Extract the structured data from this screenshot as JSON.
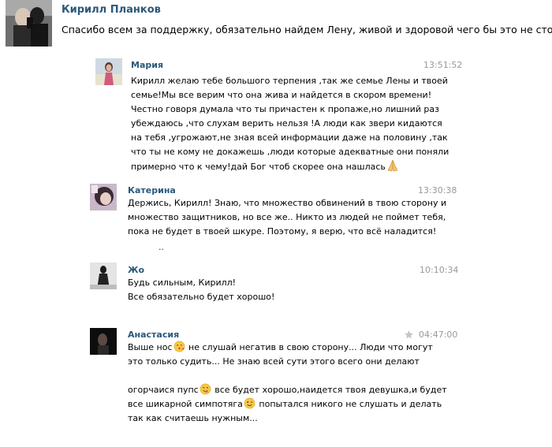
{
  "post": {
    "author": "Кирилл Планков",
    "text": "Спасибо всем за поддержку, обязательно найдем Лену, живой и здоровой чего бы это не стоило."
  },
  "comments": [
    {
      "name": "Мария",
      "time": "13:51:52",
      "lines": [
        "Кирилл желаю тебе большого терпения ,так же семье Лены и твоей",
        "семье!Мы все верим что она жива и найдется в скором времени!",
        "Честно говоря думала что ты причастен к пропаже,но лишний раз",
        "убеждаюсь ,что слухам верить нельзя !А люди как звери кидаются",
        "на тебя ,угрожают,не зная всей информации даже на половину ,так",
        "что ты не кому не докажешь ,люди которые адекватные они поняли",
        "примерно что к чему!дай Бог чтоб скорее она нашлась"
      ]
    },
    {
      "name": "Катерина",
      "time": "13:30:38",
      "lines": [
        "Держись, Кирилл! Знаю, что множество обвинений в твою сторону и",
        "множество защитников, но все же.. Никто из людей не поймет тебя,",
        "пока не будет в твоей шкуре. Поэтому, я верю, что всё наладится!"
      ],
      "extra": ".."
    },
    {
      "name": "Жо",
      "time": "10:10:34",
      "lines": [
        "Будь сильным, Кирилл!",
        "Все обязательно будет хорошо!"
      ]
    },
    {
      "name": "Анастасия",
      "time": "04:47:00",
      "lines_a": [
        "Выше нос",
        " не слушай негатив в свою сторону... Люди что могут",
        "это только судить... Не знаю всей сути этого всего они делают"
      ],
      "lines_b": [
        "огорчаися пупс",
        " все будет хорошо,наидется твоя девушка,и будет",
        "все шикарной симпотяга",
        " попытался никого не слушать и делать",
        "так как считаешь нужным..."
      ]
    }
  ],
  "icons": {
    "star": "star-icon",
    "praying_hands": "praying-hands-emoji",
    "kiss": "kissing-face-emoji",
    "tongue": "face-savoring-emoji",
    "wink": "winking-face-emoji"
  },
  "colors": {
    "name": "#2b587a",
    "time": "#999999"
  }
}
